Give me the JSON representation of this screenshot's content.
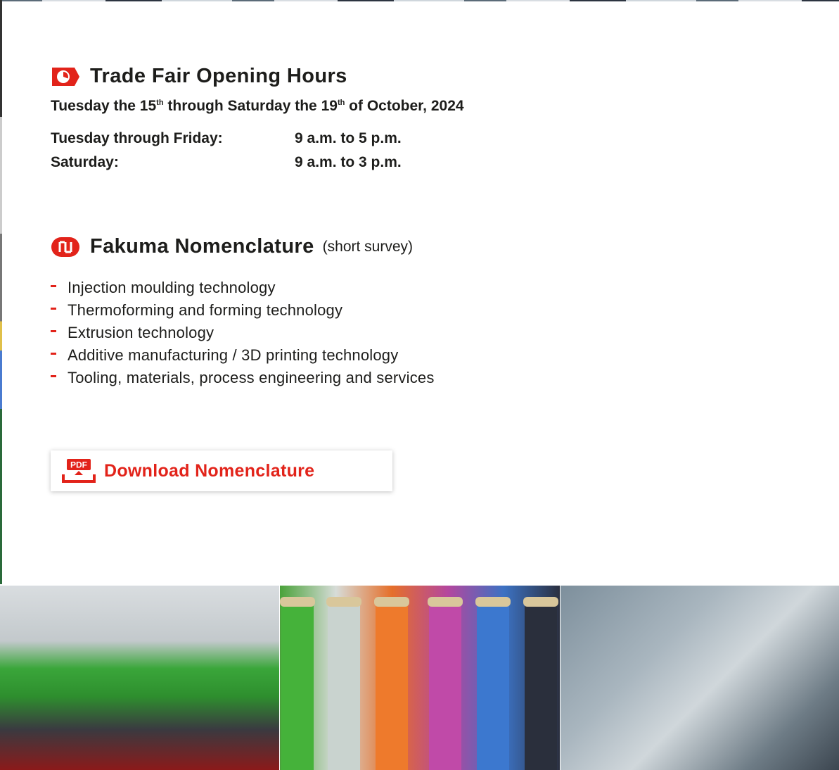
{
  "opening_hours": {
    "title": "Trade Fair Opening Hours",
    "dates": {
      "p1": "Tuesday the 15",
      "sup1": "th",
      "p2": " through Saturday the 19",
      "sup2": "th",
      "p3": " of October, 2024"
    },
    "rows": [
      {
        "day": "Tuesday through Friday:",
        "time": "9 a.m. to 5 p.m."
      },
      {
        "day": "Saturday:",
        "time": "9 a.m. to 3 p.m."
      }
    ],
    "icon": "clock-icon"
  },
  "nomenclature": {
    "title": "Fakuma Nomenclature",
    "subtitle": "(short survey)",
    "icon": "fakuma-logo-icon",
    "items": [
      "Injection moulding technology",
      "Thermoforming and forming technology",
      "Extrusion technology",
      "Additive manufacturing / 3D printing technology",
      "Tooling, materials, process engineering and services"
    ]
  },
  "download": {
    "label": "Download Nomenclature",
    "icon_text": "PDF",
    "icon": "pdf-download-icon"
  },
  "colors": {
    "accent": "#e2231a",
    "text": "#1d1d1b"
  }
}
